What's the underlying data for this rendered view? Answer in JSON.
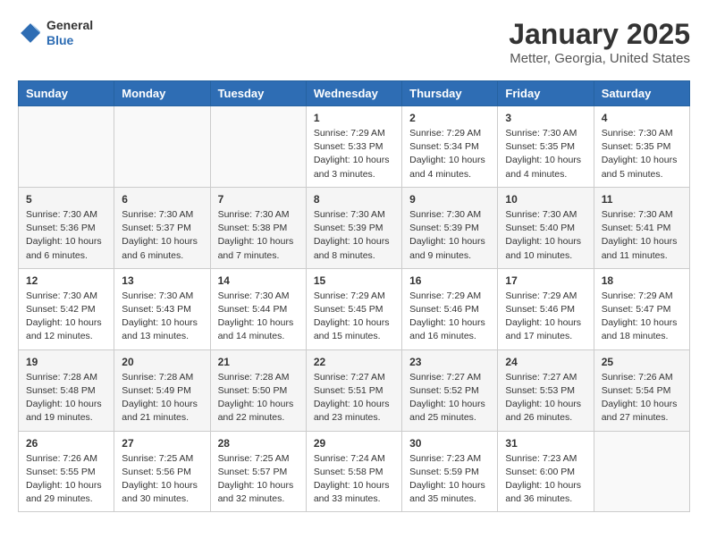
{
  "header": {
    "logo_text_top": "General",
    "logo_text_bottom": "Blue",
    "title": "January 2025",
    "subtitle": "Metter, Georgia, United States"
  },
  "calendar": {
    "weekdays": [
      "Sunday",
      "Monday",
      "Tuesday",
      "Wednesday",
      "Thursday",
      "Friday",
      "Saturday"
    ],
    "weeks": [
      [
        {
          "day": "",
          "detail": ""
        },
        {
          "day": "",
          "detail": ""
        },
        {
          "day": "",
          "detail": ""
        },
        {
          "day": "1",
          "detail": "Sunrise: 7:29 AM\nSunset: 5:33 PM\nDaylight: 10 hours\nand 3 minutes."
        },
        {
          "day": "2",
          "detail": "Sunrise: 7:29 AM\nSunset: 5:34 PM\nDaylight: 10 hours\nand 4 minutes."
        },
        {
          "day": "3",
          "detail": "Sunrise: 7:30 AM\nSunset: 5:35 PM\nDaylight: 10 hours\nand 4 minutes."
        },
        {
          "day": "4",
          "detail": "Sunrise: 7:30 AM\nSunset: 5:35 PM\nDaylight: 10 hours\nand 5 minutes."
        }
      ],
      [
        {
          "day": "5",
          "detail": "Sunrise: 7:30 AM\nSunset: 5:36 PM\nDaylight: 10 hours\nand 6 minutes."
        },
        {
          "day": "6",
          "detail": "Sunrise: 7:30 AM\nSunset: 5:37 PM\nDaylight: 10 hours\nand 6 minutes."
        },
        {
          "day": "7",
          "detail": "Sunrise: 7:30 AM\nSunset: 5:38 PM\nDaylight: 10 hours\nand 7 minutes."
        },
        {
          "day": "8",
          "detail": "Sunrise: 7:30 AM\nSunset: 5:39 PM\nDaylight: 10 hours\nand 8 minutes."
        },
        {
          "day": "9",
          "detail": "Sunrise: 7:30 AM\nSunset: 5:39 PM\nDaylight: 10 hours\nand 9 minutes."
        },
        {
          "day": "10",
          "detail": "Sunrise: 7:30 AM\nSunset: 5:40 PM\nDaylight: 10 hours\nand 10 minutes."
        },
        {
          "day": "11",
          "detail": "Sunrise: 7:30 AM\nSunset: 5:41 PM\nDaylight: 10 hours\nand 11 minutes."
        }
      ],
      [
        {
          "day": "12",
          "detail": "Sunrise: 7:30 AM\nSunset: 5:42 PM\nDaylight: 10 hours\nand 12 minutes."
        },
        {
          "day": "13",
          "detail": "Sunrise: 7:30 AM\nSunset: 5:43 PM\nDaylight: 10 hours\nand 13 minutes."
        },
        {
          "day": "14",
          "detail": "Sunrise: 7:30 AM\nSunset: 5:44 PM\nDaylight: 10 hours\nand 14 minutes."
        },
        {
          "day": "15",
          "detail": "Sunrise: 7:29 AM\nSunset: 5:45 PM\nDaylight: 10 hours\nand 15 minutes."
        },
        {
          "day": "16",
          "detail": "Sunrise: 7:29 AM\nSunset: 5:46 PM\nDaylight: 10 hours\nand 16 minutes."
        },
        {
          "day": "17",
          "detail": "Sunrise: 7:29 AM\nSunset: 5:46 PM\nDaylight: 10 hours\nand 17 minutes."
        },
        {
          "day": "18",
          "detail": "Sunrise: 7:29 AM\nSunset: 5:47 PM\nDaylight: 10 hours\nand 18 minutes."
        }
      ],
      [
        {
          "day": "19",
          "detail": "Sunrise: 7:28 AM\nSunset: 5:48 PM\nDaylight: 10 hours\nand 19 minutes."
        },
        {
          "day": "20",
          "detail": "Sunrise: 7:28 AM\nSunset: 5:49 PM\nDaylight: 10 hours\nand 21 minutes."
        },
        {
          "day": "21",
          "detail": "Sunrise: 7:28 AM\nSunset: 5:50 PM\nDaylight: 10 hours\nand 22 minutes."
        },
        {
          "day": "22",
          "detail": "Sunrise: 7:27 AM\nSunset: 5:51 PM\nDaylight: 10 hours\nand 23 minutes."
        },
        {
          "day": "23",
          "detail": "Sunrise: 7:27 AM\nSunset: 5:52 PM\nDaylight: 10 hours\nand 25 minutes."
        },
        {
          "day": "24",
          "detail": "Sunrise: 7:27 AM\nSunset: 5:53 PM\nDaylight: 10 hours\nand 26 minutes."
        },
        {
          "day": "25",
          "detail": "Sunrise: 7:26 AM\nSunset: 5:54 PM\nDaylight: 10 hours\nand 27 minutes."
        }
      ],
      [
        {
          "day": "26",
          "detail": "Sunrise: 7:26 AM\nSunset: 5:55 PM\nDaylight: 10 hours\nand 29 minutes."
        },
        {
          "day": "27",
          "detail": "Sunrise: 7:25 AM\nSunset: 5:56 PM\nDaylight: 10 hours\nand 30 minutes."
        },
        {
          "day": "28",
          "detail": "Sunrise: 7:25 AM\nSunset: 5:57 PM\nDaylight: 10 hours\nand 32 minutes."
        },
        {
          "day": "29",
          "detail": "Sunrise: 7:24 AM\nSunset: 5:58 PM\nDaylight: 10 hours\nand 33 minutes."
        },
        {
          "day": "30",
          "detail": "Sunrise: 7:23 AM\nSunset: 5:59 PM\nDaylight: 10 hours\nand 35 minutes."
        },
        {
          "day": "31",
          "detail": "Sunrise: 7:23 AM\nSunset: 6:00 PM\nDaylight: 10 hours\nand 36 minutes."
        },
        {
          "day": "",
          "detail": ""
        }
      ]
    ]
  }
}
